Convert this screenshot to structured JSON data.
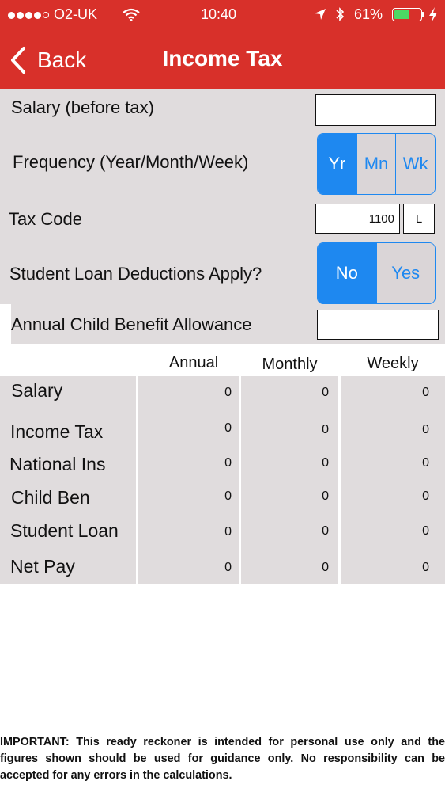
{
  "status_bar": {
    "carrier": "O2-UK",
    "time": "10:40",
    "battery_percent": "61%",
    "battery_level": 0.61,
    "wifi_icon": "wifi-icon",
    "location_icon": "location-arrow-icon",
    "bluetooth_icon": "bluetooth-icon",
    "charging_icon": "charging-bolt-icon"
  },
  "nav": {
    "back_label": "Back",
    "title": "Income Tax"
  },
  "form": {
    "salary_label": "Salary (before tax)",
    "salary_value": "",
    "frequency_label": "Frequency (Year/Month/Week)",
    "frequency_options": [
      "Yr",
      "Mn",
      "Wk"
    ],
    "frequency_selected": "Yr",
    "tax_code_label": "Tax Code",
    "tax_code_number": "1100",
    "tax_code_letter": "L",
    "student_loan_label": "Student Loan Deductions Apply?",
    "student_loan_options": [
      "No",
      "Yes"
    ],
    "student_loan_selected": "No",
    "child_benefit_label": "Annual Child Benefit Allowance",
    "child_benefit_value": ""
  },
  "table": {
    "headers": [
      "Annual",
      "Monthly",
      "Weekly"
    ],
    "rows": [
      {
        "label": "Salary",
        "values": [
          "0",
          "0",
          "0"
        ]
      },
      {
        "label": "Income Tax",
        "values": [
          "0",
          "0",
          "0"
        ]
      },
      {
        "label": "National Ins",
        "values": [
          "0",
          "0",
          "0"
        ]
      },
      {
        "label": "Child Ben",
        "values": [
          "0",
          "0",
          "0"
        ]
      },
      {
        "label": "Student Loan",
        "values": [
          "0",
          "0",
          "0"
        ]
      },
      {
        "label": "Net Pay",
        "values": [
          "0",
          "0",
          "0"
        ]
      }
    ]
  },
  "disclaimer": "IMPORTANT: This ready reckoner is intended for personal use only and the figures shown should be used for guidance only. No responsibility can be accepted for any errors in the calculations.",
  "colors": {
    "header_red": "#d8302a",
    "accent_blue": "#1e88f0",
    "panel_grey": "#e0dcdd",
    "battery_green": "#4cd964"
  }
}
